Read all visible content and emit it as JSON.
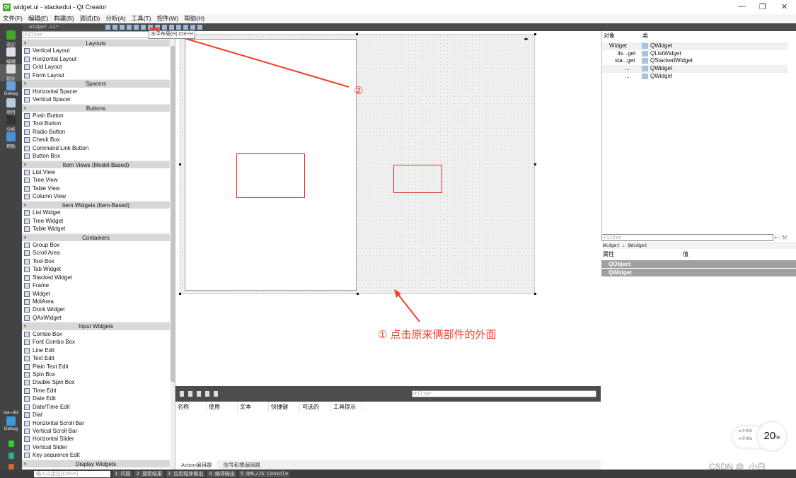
{
  "window": {
    "title": "widget.ui - stackedui - Qt Creator",
    "logo": "Qt"
  },
  "menu": [
    "文件(F)",
    "编辑(E)",
    "构建(B)",
    "调试(D)",
    "分析(A)",
    "工具(T)",
    "控件(W)",
    "帮助(H)"
  ],
  "toolbar": {
    "document": "widget.ui*",
    "tooltip": "水平布局(H) Ctrl+H"
  },
  "modes": [
    {
      "label": "欢迎",
      "icon": "qt-welcome-icon"
    },
    {
      "label": "编辑",
      "icon": "edit-icon"
    },
    {
      "label": "设计",
      "icon": "design-icon"
    },
    {
      "label": "Debug",
      "icon": "debug-icon"
    },
    {
      "label": "项目",
      "icon": "project-icon"
    },
    {
      "label": "分析",
      "icon": "analyze-icon"
    },
    {
      "label": "帮助",
      "icon": "help-icon"
    }
  ],
  "kit": {
    "project": "sta--dui",
    "config": "Debug"
  },
  "widgetbox": {
    "filter_placeholder": "Filter",
    "sections": [
      {
        "title": "Layouts",
        "items": [
          "Vertical Layout",
          "Horizontal Layout",
          "Grid Layout",
          "Form Layout"
        ]
      },
      {
        "title": "Spacers",
        "items": [
          "Horizontal Spacer",
          "Vertical Spacer"
        ]
      },
      {
        "title": "Buttons",
        "items": [
          "Push Button",
          "Tool Button",
          "Radio Button",
          "Check Box",
          "Command Link Button",
          "Button Box"
        ]
      },
      {
        "title": "Item Views (Model-Based)",
        "items": [
          "List View",
          "Tree View",
          "Table View",
          "Column View"
        ]
      },
      {
        "title": "Item Widgets (Item-Based)",
        "items": [
          "List Widget",
          "Tree Widget",
          "Table Widget"
        ]
      },
      {
        "title": "Containers",
        "items": [
          "Group Box",
          "Scroll Area",
          "Tool Box",
          "Tab Widget",
          "Stacked Widget",
          "Frame",
          "Widget",
          "MdiArea",
          "Dock Widget",
          "QAxWidget"
        ]
      },
      {
        "title": "Input Widgets",
        "items": [
          "Combo Box",
          "Font Combo Box",
          "Line Edit",
          "Text Edit",
          "Plain Text Edit",
          "Spin Box",
          "Double Spin Box",
          "Time Edit",
          "Date Edit",
          "Date/Time Edit",
          "Dial",
          "Horizontal Scroll Bar",
          "Vertical Scroll Bar",
          "Horizontal Slider",
          "Vertical Slider",
          "Key sequence Edit"
        ]
      },
      {
        "title": "Display Widgets",
        "items": []
      }
    ]
  },
  "annotations": {
    "step1": "① 点击原来俩部件的外面",
    "step2": "②",
    "color": "#f0402a"
  },
  "action_editor": {
    "filter_placeholder": "Filter",
    "columns": [
      "名称",
      "使用",
      "文本",
      "快捷键",
      "可选的",
      "工具提示"
    ],
    "tabs": [
      "Action编辑器",
      "信号和槽编辑器"
    ]
  },
  "object_inspector": {
    "columns": [
      "对象",
      "类"
    ],
    "rows": [
      {
        "name": "Widget",
        "class": "QWidget"
      },
      {
        "name": "lis...get",
        "class": "QListWidget"
      },
      {
        "name": "sta...get",
        "class": "QStackedWidget"
      },
      {
        "name": "...",
        "class": "QWidget"
      },
      {
        "name": "...",
        "class": "QWidget"
      }
    ]
  },
  "property_editor": {
    "filter_placeholder": "Filter",
    "subtitle": "Widget : QWidget",
    "columns": [
      "属性",
      "值"
    ],
    "groups": [
      "QObject",
      "QWidget"
    ]
  },
  "statusbar": {
    "locator_placeholder": "输入以定位(Ctrl+K)",
    "panes": [
      "1 问题",
      "2 搜索结果",
      "3 应用程序输出",
      "4 编译输出",
      "5 QML/JS Console"
    ]
  },
  "net_widget": {
    "up": "0",
    "down": "0",
    "unit": "K/s",
    "percent": "20",
    "percent_sign": "%"
  },
  "watermark": "CSDN @_小白__"
}
